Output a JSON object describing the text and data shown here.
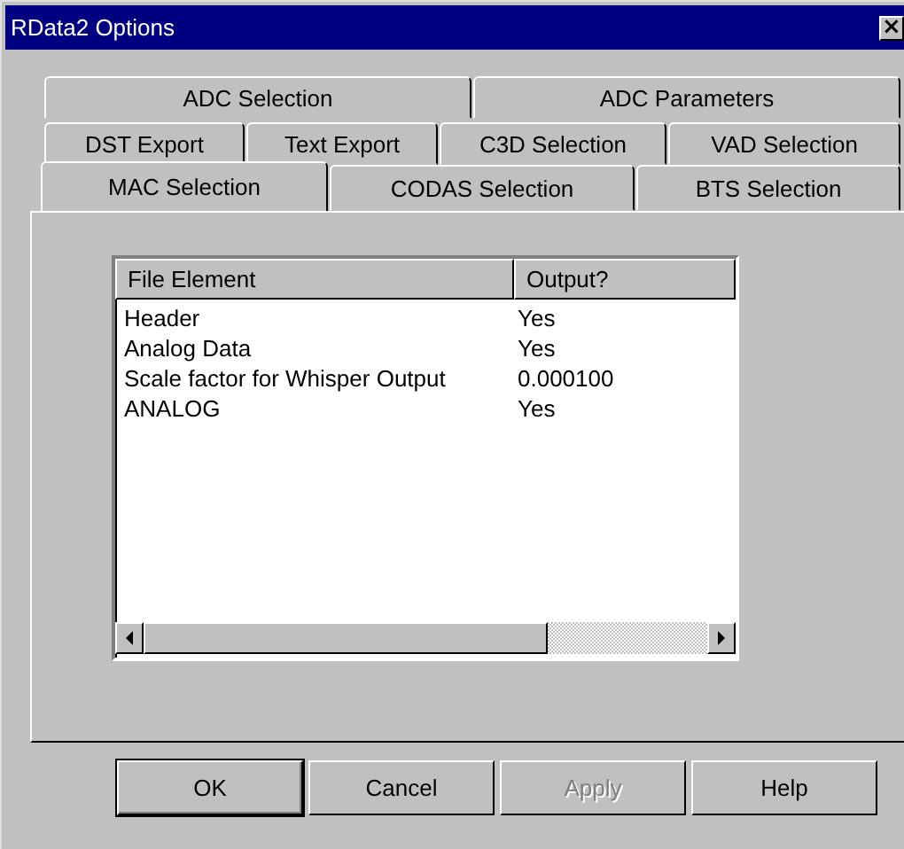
{
  "window": {
    "title": "RData2 Options",
    "close": "×"
  },
  "tab_rows": [
    {
      "tabs": [
        {
          "label": "ADC Selection",
          "selected": false
        },
        {
          "label": "ADC Parameters",
          "selected": false
        }
      ]
    },
    {
      "tabs": [
        {
          "label": "DST Export",
          "selected": false
        },
        {
          "label": "Text Export",
          "selected": false
        },
        {
          "label": "C3D Selection",
          "selected": false
        },
        {
          "label": "VAD Selection",
          "selected": false
        }
      ]
    },
    {
      "tabs": [
        {
          "label": "MAC Selection",
          "selected": true
        },
        {
          "label": "CODAS Selection",
          "selected": false
        },
        {
          "label": "BTS Selection",
          "selected": false
        }
      ]
    }
  ],
  "list": {
    "columns": [
      "File Element",
      "Output?"
    ],
    "rows": [
      [
        "Header",
        "Yes"
      ],
      [
        "Analog Data",
        "Yes"
      ],
      [
        "Scale factor for Whisper Output",
        "0.000100"
      ],
      [
        "ANALOG",
        "Yes"
      ]
    ]
  },
  "buttons": [
    {
      "label": "OK",
      "default": true,
      "disabled": false
    },
    {
      "label": "Cancel",
      "default": false,
      "disabled": false
    },
    {
      "label": "Apply",
      "default": false,
      "disabled": true
    },
    {
      "label": "Help",
      "default": false,
      "disabled": false
    }
  ]
}
